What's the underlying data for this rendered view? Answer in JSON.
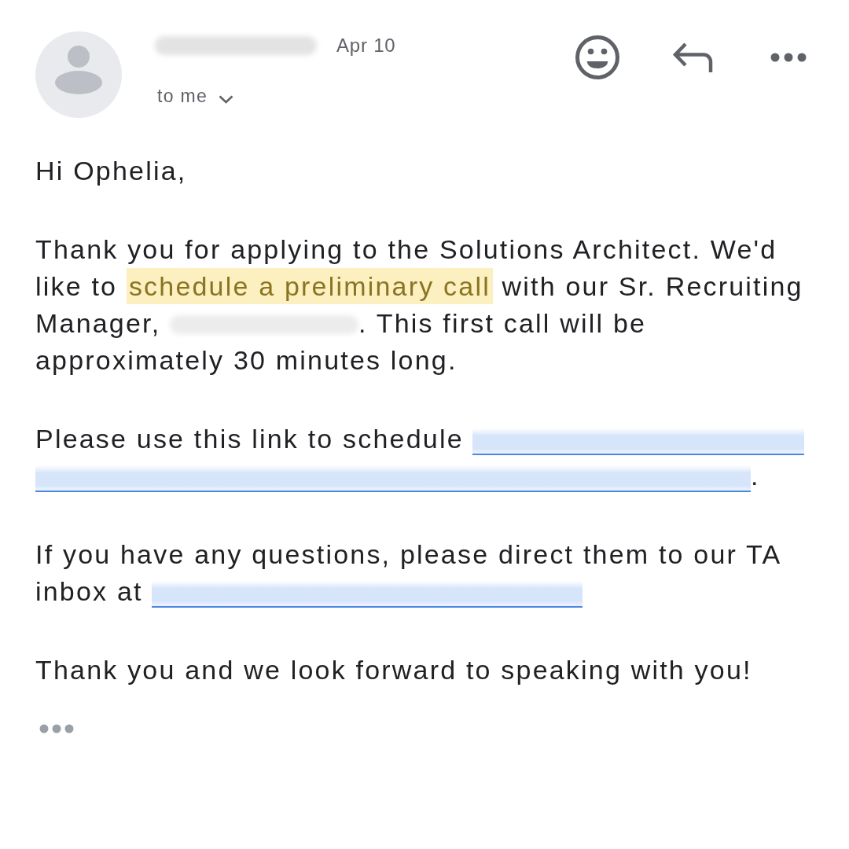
{
  "message": {
    "date": "Apr 10",
    "recipient": "to me"
  },
  "body": {
    "greeting": "Hi Ophelia,",
    "paragraphs": [
      [
        {
          "kind": "text",
          "text": "Thank you for applying to the Solutions Architect. We'd like to "
        },
        {
          "kind": "highlight",
          "text": "schedule a preliminary call"
        },
        {
          "kind": "text",
          "text": " with our Sr. Recruiting Manager, "
        },
        {
          "kind": "redacted_name"
        },
        {
          "kind": "text",
          "text": ". This first call will be approximately 30 minutes long."
        }
      ],
      [
        {
          "kind": "text",
          "text": "Please use this link to schedule "
        },
        {
          "kind": "redacted_link"
        },
        {
          "kind": "redacted_link"
        },
        {
          "kind": "text",
          "text": "."
        }
      ],
      [
        {
          "kind": "text",
          "text": "If you have any questions, please direct them to our TA inbox at "
        },
        {
          "kind": "redacted_link"
        }
      ],
      [
        {
          "kind": "text",
          "text": "Thank you and we look forward to speaking with you!"
        }
      ]
    ]
  }
}
